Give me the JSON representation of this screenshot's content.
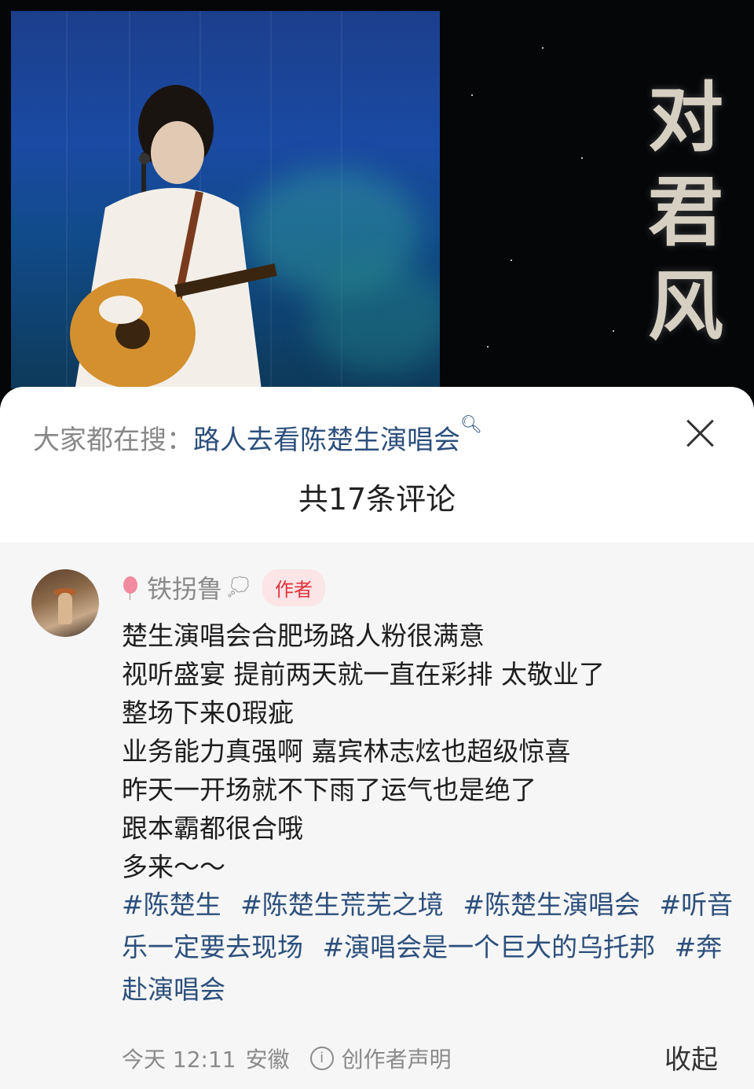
{
  "hero": {
    "calligraphy_text": "对君风"
  },
  "sheet": {
    "search_prefix": "大家都在搜：",
    "search_keyword": "路人去看陈楚生演唱会",
    "comment_count_label": "共17条评论"
  },
  "comment": {
    "username": "铁拐鲁",
    "author_badge": "作者",
    "lines": [
      "楚生演唱会合肥场路人粉很满意",
      "视听盛宴 提前两天就一直在彩排 太敬业了",
      "整场下来0瑕疵",
      "业务能力真强啊 嘉宾林志炫也超级惊喜",
      "昨天一开场就不下雨了运气也是绝了",
      "跟本霸都很合哦",
      "多来～～"
    ],
    "hashtags": [
      "#陈楚生",
      "#陈楚生荒芜之境",
      "#陈楚生演唱会",
      "#听音乐一定要去现场",
      "#演唱会是一个巨大的乌托邦",
      "#奔赴演唱会"
    ],
    "time": "今天 12:11",
    "location": "安徽",
    "creator_statement": "创作者声明",
    "collapse_label": "收起"
  },
  "icons": {
    "close": "close-icon",
    "search": "search-icon",
    "info": "info-icon",
    "balloon": "balloon-icon",
    "thought": "thought-bubble-icon"
  },
  "colors": {
    "link": "#2c4f7c",
    "author_badge_text": "#e0323e",
    "author_badge_bg": "#fbe5e6"
  }
}
